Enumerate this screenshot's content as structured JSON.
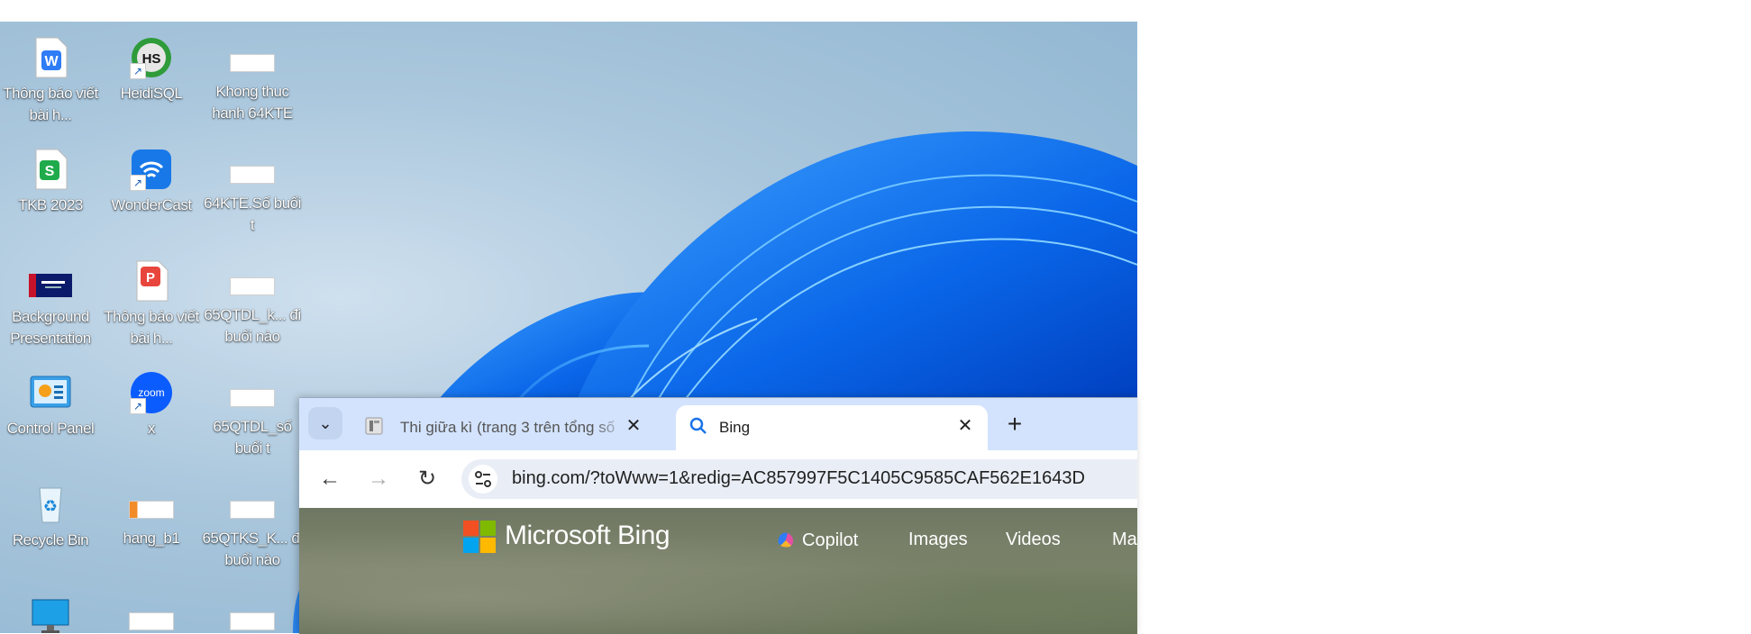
{
  "desktop": {
    "icons": [
      {
        "label": "Thông báo viết bài h...",
        "icon": "wps-writer-doc-icon"
      },
      {
        "label": "HeidiSQL",
        "icon": "heidisql-icon"
      },
      {
        "label": "Khong thuc hanh 64KTE",
        "icon": "sheet-thumbnail-icon"
      },
      {
        "label": "TKB 2023",
        "icon": "wps-spreadsheet-icon"
      },
      {
        "label": "WonderCast",
        "icon": "wondercast-icon"
      },
      {
        "label": "64KTE.Số buổi t",
        "icon": "sheet-thumbnail-icon"
      },
      {
        "label": "Background Presentation",
        "icon": "presentation-thumbnail-icon"
      },
      {
        "label": "Thông báo viết bài h...",
        "icon": "wps-pdf-icon"
      },
      {
        "label": "65QTDL_k... đi buổi nào",
        "icon": "sheet-thumbnail-icon"
      },
      {
        "label": "Control Panel",
        "icon": "control-panel-icon"
      },
      {
        "label": "x",
        "icon": "zoom-icon"
      },
      {
        "label": "65QTDL_số buổi t",
        "icon": "sheet-thumbnail-icon"
      },
      {
        "label": "Recycle Bin",
        "icon": "recycle-bin-icon"
      },
      {
        "label": "hang_b1",
        "icon": "sheet-thumbnail-icon"
      },
      {
        "label": "65QTKS_K... đi buổi nào",
        "icon": "sheet-thumbnail-icon"
      },
      {
        "label": "",
        "icon": "monitor-icon"
      },
      {
        "label": "",
        "icon": "sheet-thumbnail-icon"
      },
      {
        "label": "",
        "icon": "sheet-thumbnail-icon"
      }
    ]
  },
  "browser": {
    "tabs": [
      {
        "title": "Thi giữa kì (trang 3 trên tổng số",
        "icon": "document-favicon-icon",
        "active": false
      },
      {
        "title": "Bing",
        "icon": "search-icon",
        "active": true
      }
    ],
    "new_tab_symbol": "+",
    "address": "bing.com/?toWww=1&redig=AC857997F5C1405C9585CAF562E1643D",
    "nav": {
      "back": "←",
      "forward": "→",
      "reload": "↻"
    },
    "close_symbol": "✕",
    "tab_search_symbol": "⌄"
  },
  "bing": {
    "brand": "Microsoft Bing",
    "nav_items": [
      "Copilot",
      "Images",
      "Videos",
      "Ma"
    ]
  }
}
